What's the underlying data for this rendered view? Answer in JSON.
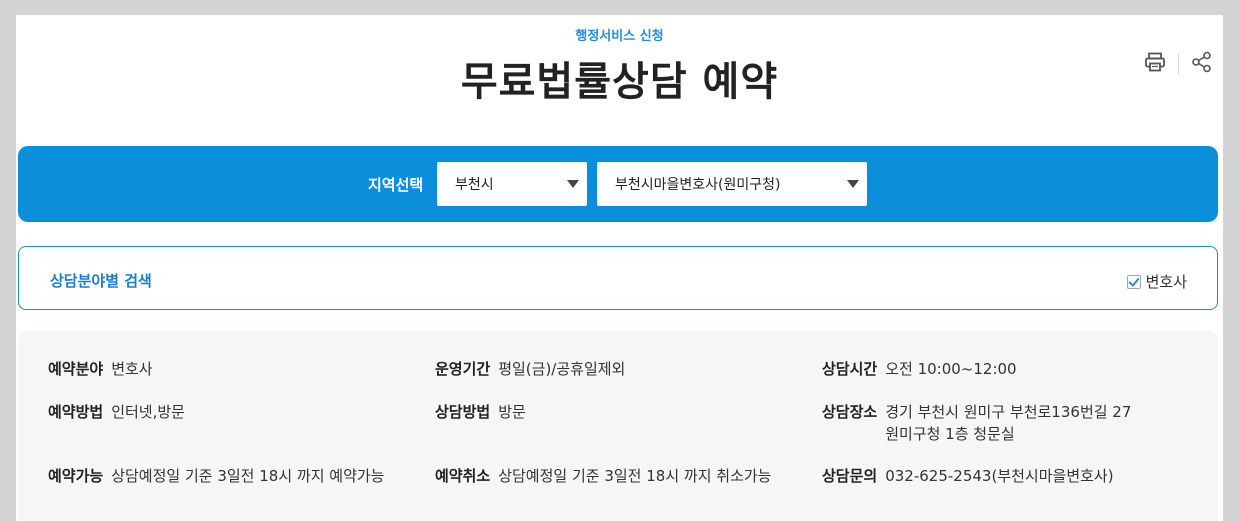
{
  "header": {
    "breadcrumb": "행정서비스 신청",
    "title": "무료법률상담 예약",
    "tools": {
      "print_icon": "printer-icon",
      "share_icon": "share-icon"
    }
  },
  "region": {
    "label": "지역선택",
    "city_select": {
      "value": "부천시"
    },
    "office_select": {
      "value": "부천시마을변호사(원미구청)"
    },
    "bar_color": "#0b8fdb"
  },
  "search": {
    "title": "상담분야별 검색",
    "checkbox": {
      "label": "변호사",
      "checked": true
    }
  },
  "info": {
    "field": {
      "key": "예약분야",
      "value": "변호사"
    },
    "period": {
      "key": "운영기간",
      "value": "평일(금)/공휴일제외"
    },
    "time": {
      "key": "상담시간",
      "value": "오전 10:00~12:00"
    },
    "method": {
      "key": "예약방법",
      "value": "인터넷,방문"
    },
    "consult_method": {
      "key": "상담방법",
      "value": "방문"
    },
    "place": {
      "key": "상담장소",
      "value": "경기 부천시 원미구 부천로136번길 27  원미구청 1층 청문실"
    },
    "available": {
      "key": "예약가능",
      "value": "상담예정일 기준 3일전 18시 까지 예약가능"
    },
    "cancel": {
      "key": "예약취소",
      "value": "상담예정일 기준 3일전 18시 까지 취소가능"
    },
    "contact": {
      "key": "상담문의",
      "value": "032-625-2543(부천시마을변호사)"
    }
  }
}
